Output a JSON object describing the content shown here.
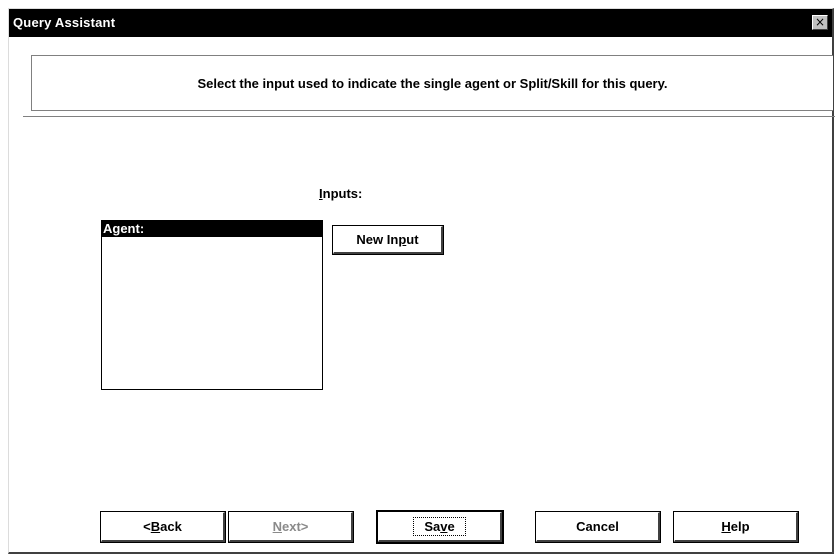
{
  "window": {
    "title": "Query Assistant",
    "close_label": "×"
  },
  "instruction": {
    "text": "Select the input used to indicate the single agent or Split/Skill for this query."
  },
  "inputs": {
    "label_mnemonic": "I",
    "label_rest": "nputs:",
    "list_items": [
      "Agent:"
    ],
    "new_input_pre": "New In",
    "new_input_mnemonic": "p",
    "new_input_post": "ut"
  },
  "footer": {
    "back_pre": "<",
    "back_mnemonic": "B",
    "back_post": "ack",
    "next_mnemonic": "N",
    "next_post": "ext>",
    "save_pre": "Sa",
    "save_mnemonic": "v",
    "save_post": "e",
    "cancel_label": "Cancel",
    "help_mnemonic": "H",
    "help_post": "elp"
  }
}
